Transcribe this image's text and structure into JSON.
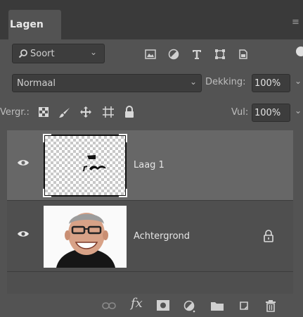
{
  "panel": {
    "tab_label": "Lagen",
    "menu_icon": "panel-menu-icon"
  },
  "filter": {
    "kind_label": "Soort",
    "icons": [
      "image-filter-icon",
      "adjustment-filter-icon",
      "type-filter-icon",
      "shape-filter-icon",
      "smart-object-filter-icon"
    ]
  },
  "blend": {
    "mode": "Normaal",
    "opacity_label": "Dekking:",
    "opacity_value": "100%"
  },
  "lock": {
    "label": "Vergr.:",
    "fill_label": "Vul:",
    "fill_value": "100%",
    "icons": [
      "lock-transparent-pixels-icon",
      "lock-image-pixels-icon",
      "lock-position-icon",
      "lock-artboard-icon",
      "lock-all-icon"
    ]
  },
  "layers": [
    {
      "name": "Laag 1",
      "visible": true,
      "selected": true,
      "locked": false,
      "thumbnail": "transparent-with-mark"
    },
    {
      "name": "Achtergrond",
      "visible": true,
      "selected": false,
      "locked": true,
      "thumbnail": "portrait-photo"
    }
  ],
  "bottom_toolbar": {
    "icons": [
      "link-layers-icon",
      "layer-style-fx-icon",
      "add-mask-icon",
      "new-adjustment-layer-icon",
      "new-group-icon",
      "new-layer-icon",
      "delete-layer-icon"
    ],
    "fx_label": "fx"
  }
}
